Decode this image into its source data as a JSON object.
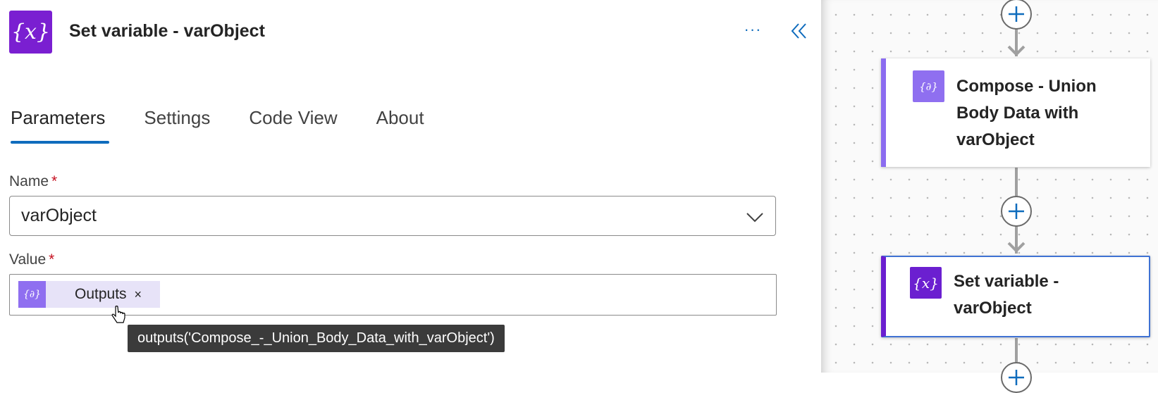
{
  "panel": {
    "title": "Set variable - varObject",
    "header_icon": "variable-icon",
    "more_label": "···",
    "tabs": [
      "Parameters",
      "Settings",
      "Code View",
      "About"
    ],
    "active_tab": "Parameters"
  },
  "fields": {
    "name": {
      "label": "Name",
      "required_mark": "*",
      "value": "varObject"
    },
    "value": {
      "label": "Value",
      "required_mark": "*",
      "token_label": "Outputs",
      "token_remove": "×",
      "tooltip": "outputs('Compose_-_Union_Body_Data_with_varObject')"
    }
  },
  "canvas": {
    "cards": [
      {
        "title_lines": [
          "Compose - Union",
          "Body Data with",
          "varObject"
        ],
        "icon": "compose-icon"
      },
      {
        "title_lines": [
          "Set variable -",
          "varObject"
        ],
        "icon": "variable-icon"
      }
    ]
  },
  "colors": {
    "variable_purple": "#7a1fd1",
    "compose_purple": "#8f6ff0",
    "accent_blue": "#0f6cbd",
    "selected_border": "#3f72d3"
  }
}
